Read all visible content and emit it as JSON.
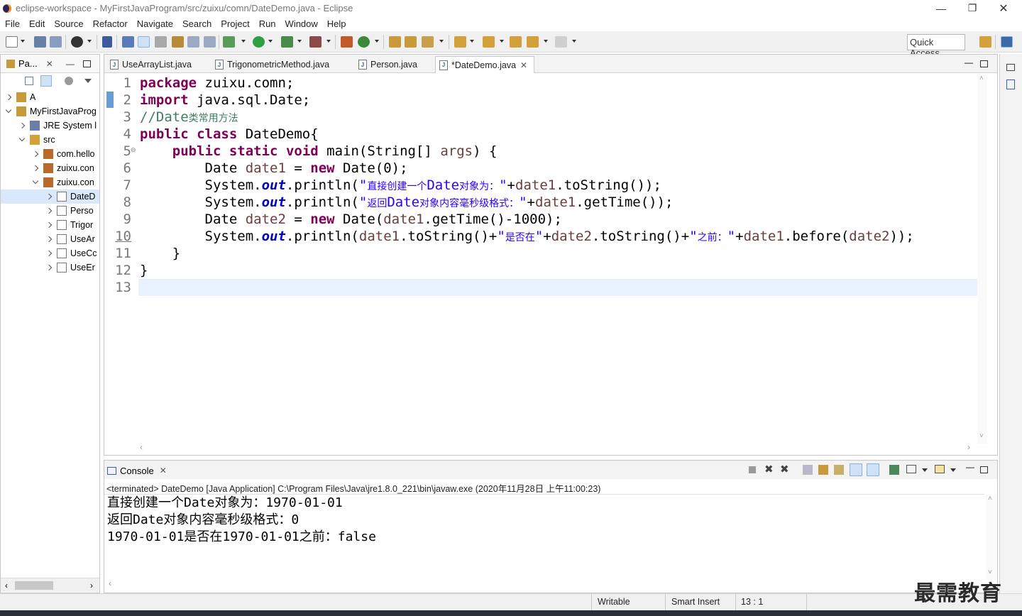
{
  "window": {
    "title": "eclipse-workspace - MyFirstJavaProgram/src/zuixu/comn/DateDemo.java - Eclipse"
  },
  "menu": [
    "File",
    "Edit",
    "Source",
    "Refactor",
    "Navigate",
    "Search",
    "Project",
    "Run",
    "Window",
    "Help"
  ],
  "quick_access": "Quick Access",
  "package_explorer": {
    "tab_label": "Pa...",
    "items": [
      {
        "label": "A",
        "depth": 0,
        "expanded": false,
        "icon": "project-icon"
      },
      {
        "label": "MyFirstJavaProg",
        "depth": 0,
        "expanded": true,
        "icon": "project-icon"
      },
      {
        "label": "JRE System l",
        "depth": 1,
        "expanded": false,
        "icon": "library-icon"
      },
      {
        "label": "src",
        "depth": 1,
        "expanded": true,
        "icon": "source-folder-icon"
      },
      {
        "label": "com.hello",
        "depth": 2,
        "expanded": false,
        "icon": "package-icon"
      },
      {
        "label": "zuixu.con",
        "depth": 2,
        "expanded": false,
        "icon": "package-icon"
      },
      {
        "label": "zuixu.con",
        "depth": 2,
        "expanded": true,
        "icon": "package-icon"
      },
      {
        "label": "DateD",
        "depth": 3,
        "expanded": false,
        "icon": "java-file-icon",
        "selected": true
      },
      {
        "label": "Perso",
        "depth": 3,
        "expanded": false,
        "icon": "java-file-icon"
      },
      {
        "label": "Trigor",
        "depth": 3,
        "expanded": false,
        "icon": "java-file-icon"
      },
      {
        "label": "UseAr",
        "depth": 3,
        "expanded": false,
        "icon": "java-file-icon"
      },
      {
        "label": "UseCc",
        "depth": 3,
        "expanded": false,
        "icon": "java-file-icon"
      },
      {
        "label": "UseEr",
        "depth": 3,
        "expanded": false,
        "icon": "java-file-icon"
      }
    ]
  },
  "editor": {
    "tabs": [
      {
        "label": "UseArrayList.java",
        "active": false
      },
      {
        "label": "TrigonometricMethod.java",
        "active": false
      },
      {
        "label": "Person.java",
        "active": false
      },
      {
        "label": "*DateDemo.java",
        "active": true
      }
    ],
    "line_numbers": [
      "1",
      "2",
      "3",
      "4",
      "5",
      "6",
      "7",
      "8",
      "9",
      "10",
      "11",
      "12",
      "13"
    ],
    "fold_marker": "⊖"
  },
  "console": {
    "tab_label": "Console",
    "header": "<terminated> DateDemo [Java Application] C:\\Program Files\\Java\\jre1.8.0_221\\bin\\javaw.exe (2020年11月28日 上午11:00:23)",
    "lines": [
      "直接创建一个Date对象为：1970-01-01",
      "返回Date对象内容毫秒级格式：0",
      "1970-01-01是否在1970-01-01之前：false"
    ]
  },
  "status": {
    "writable": "Writable",
    "insert_mode": "Smart Insert",
    "position": "13 : 1"
  },
  "watermark": "最需教育",
  "colors": {
    "keyword": "#7f0055",
    "comment": "#3f7f5f",
    "string": "#2a00ff",
    "field": "#0000c0",
    "local_var": "#6a3e3e",
    "current_line": "#e8f2fe"
  }
}
